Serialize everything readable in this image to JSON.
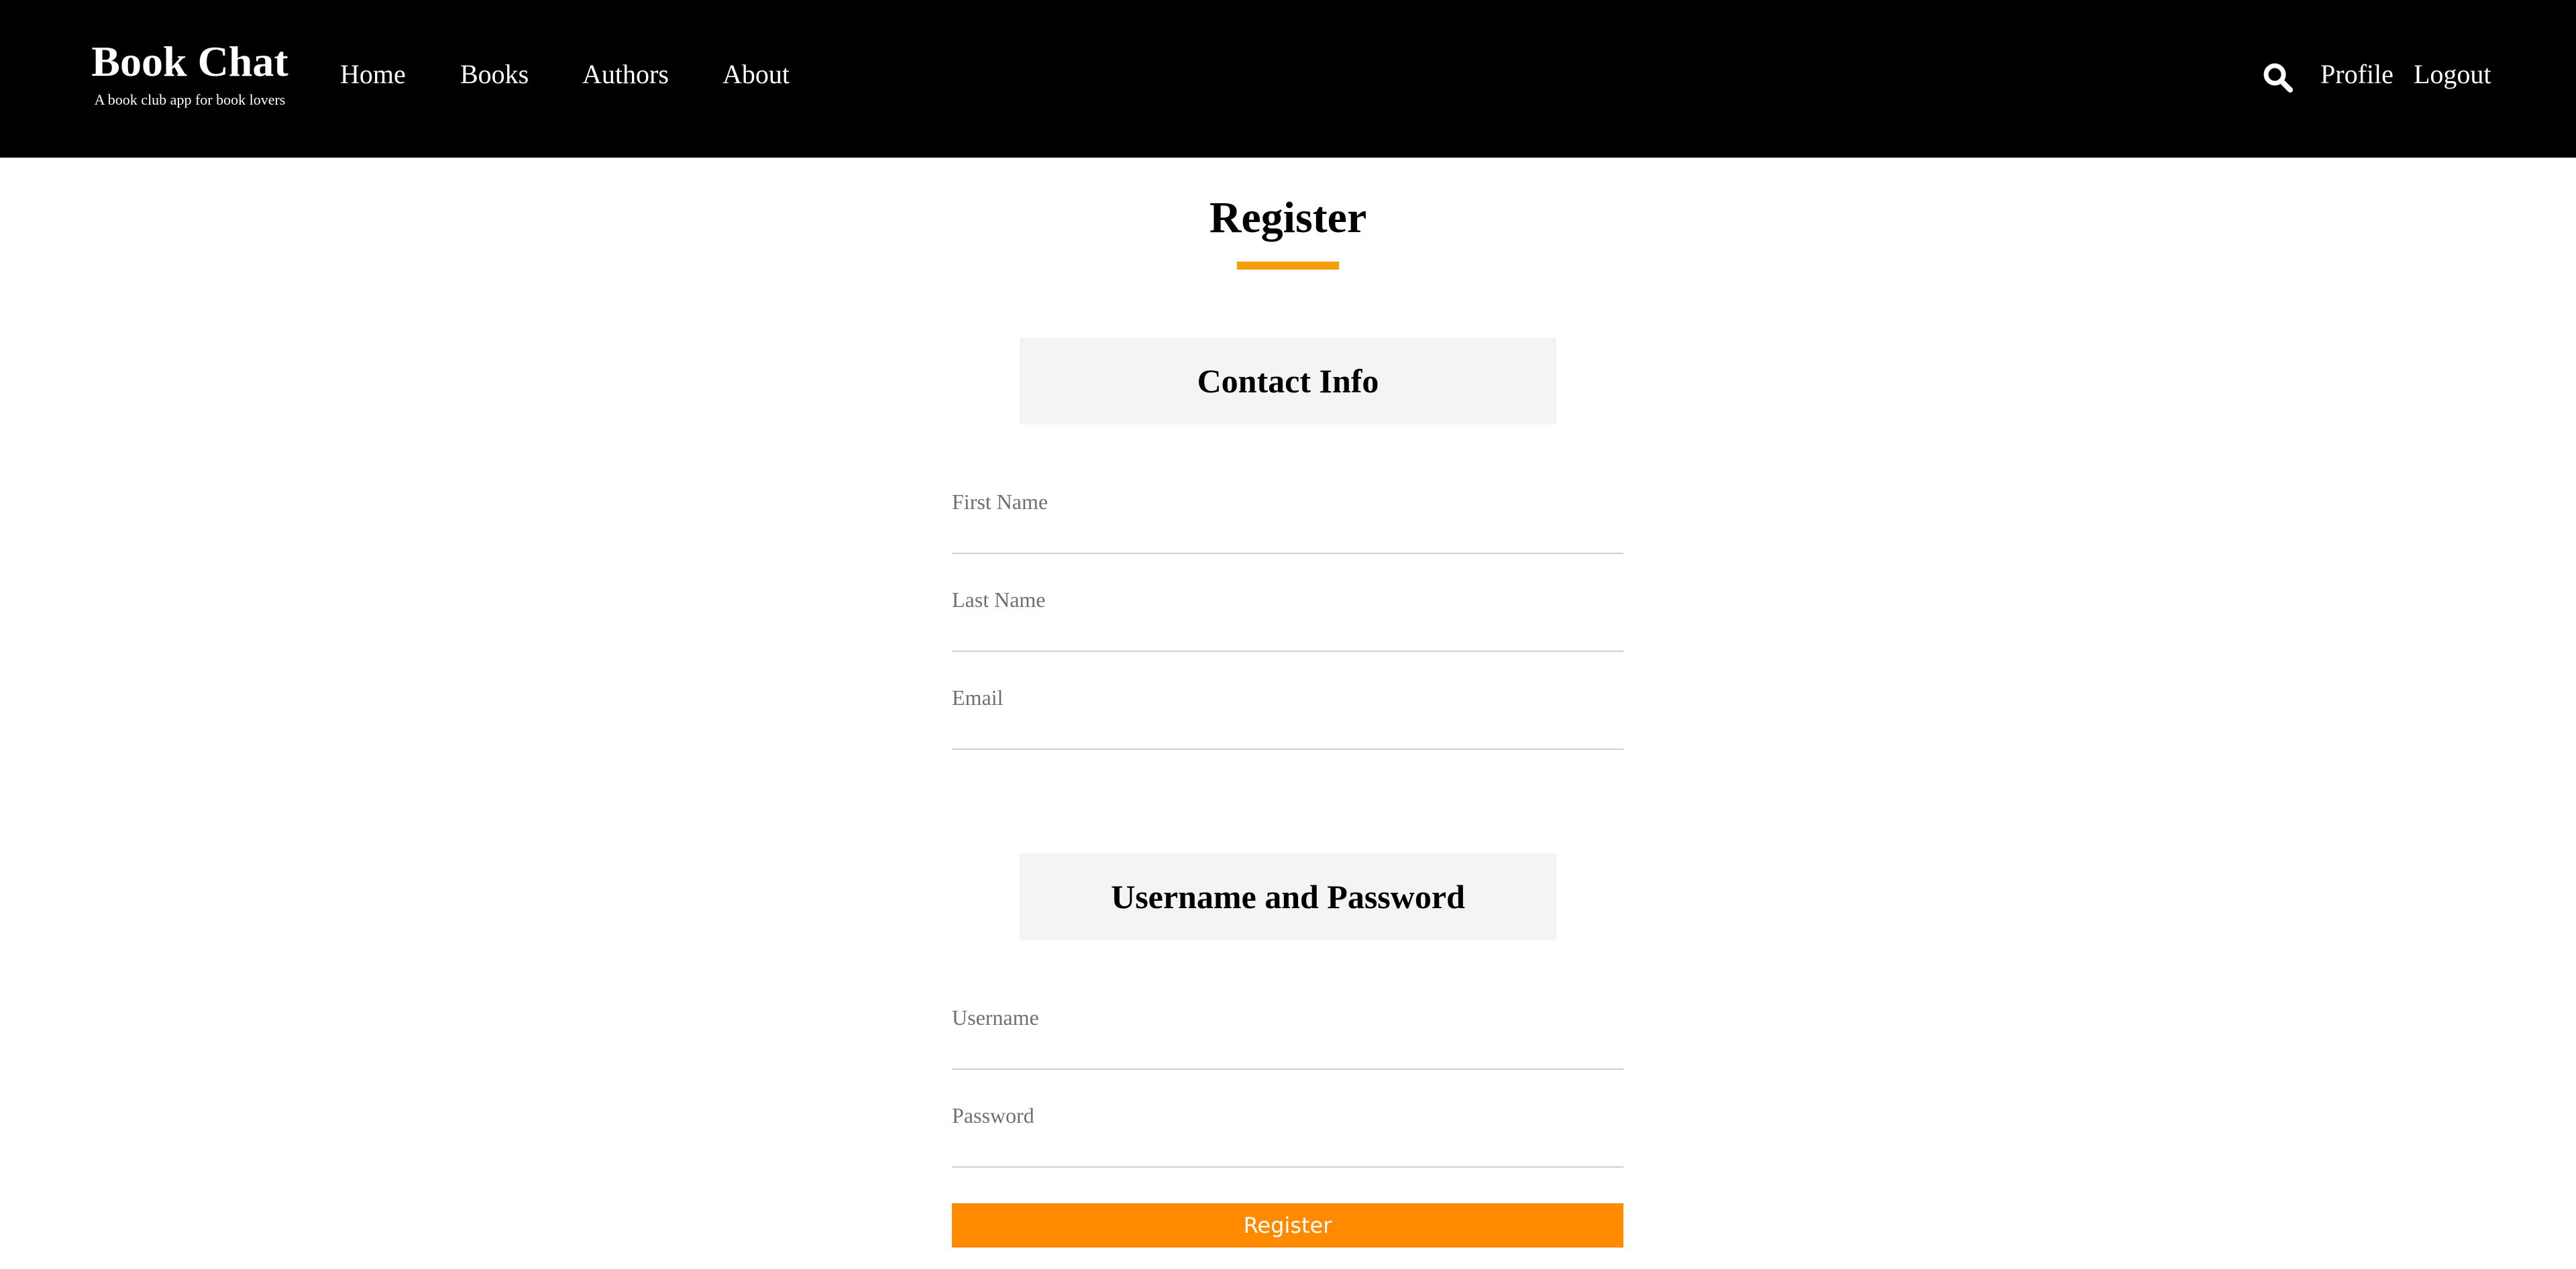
{
  "header": {
    "brand_title": "Book Chat",
    "brand_tagline": "A book club app for book lovers",
    "nav": {
      "home": "Home",
      "books": "Books",
      "authors": "Authors",
      "about": "About"
    },
    "search_icon": "search-icon",
    "profile": "Profile",
    "logout": "Logout"
  },
  "page": {
    "title": "Register",
    "accent_color": "#f5a00a"
  },
  "sections": {
    "contact": {
      "heading": "Contact Info",
      "fields": {
        "first_name": {
          "label": "First Name",
          "value": ""
        },
        "last_name": {
          "label": "Last Name",
          "value": ""
        },
        "email": {
          "label": "Email",
          "value": ""
        }
      }
    },
    "account": {
      "heading": "Username and Password",
      "fields": {
        "username": {
          "label": "Username",
          "value": ""
        },
        "password": {
          "label": "Password",
          "value": ""
        }
      }
    }
  },
  "actions": {
    "register_label": "Register",
    "register_color": "#ff8a00"
  }
}
